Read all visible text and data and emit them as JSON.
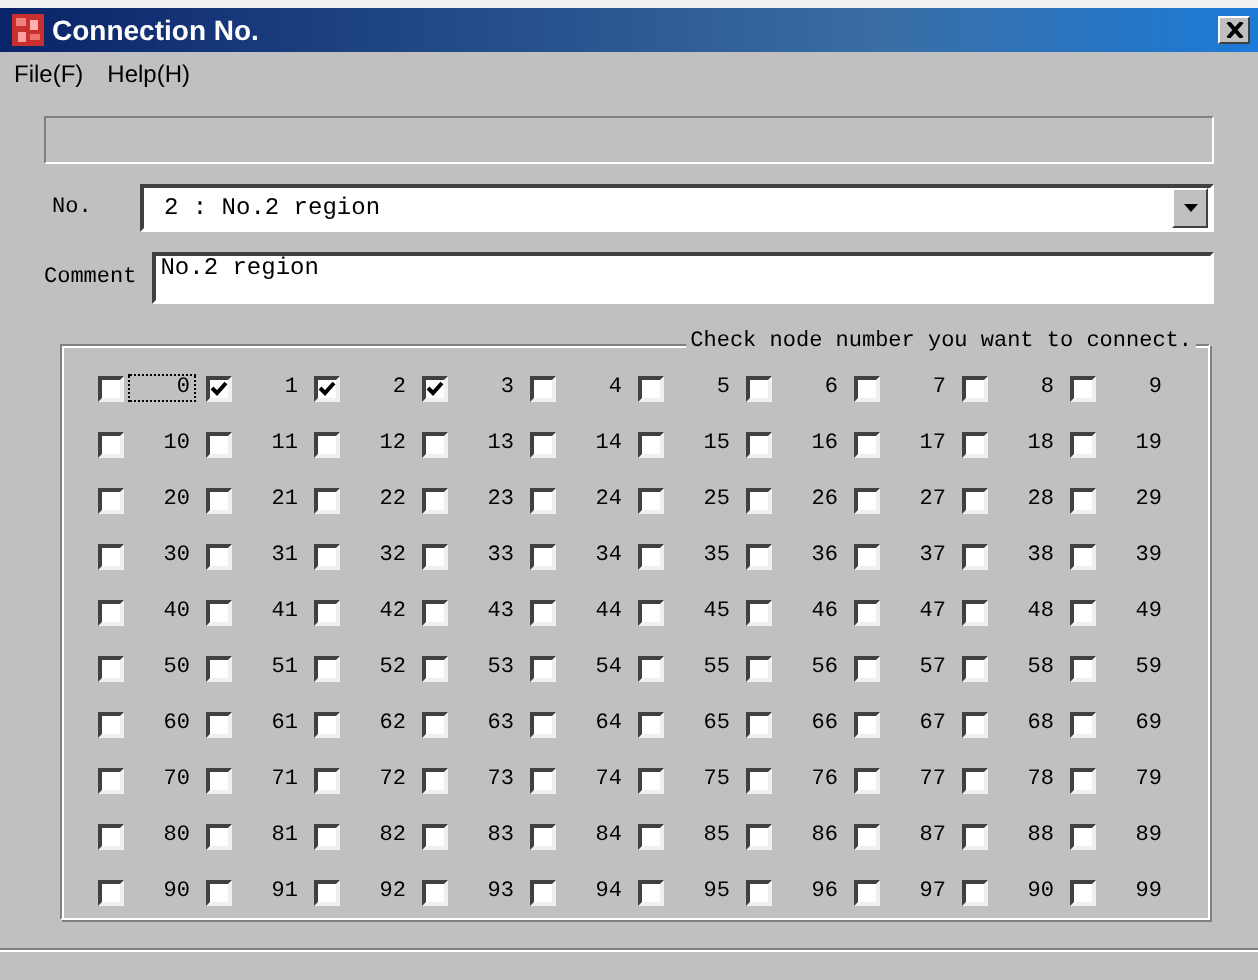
{
  "window": {
    "title": "Connection No."
  },
  "menu": [
    {
      "label": "File(F)"
    },
    {
      "label": "Help(H)"
    }
  ],
  "no": {
    "label": "No.",
    "value": "2 : No.2 region"
  },
  "comment": {
    "label": "Comment",
    "value": "No.2 region"
  },
  "group": {
    "title": "Check node number you want to connect.",
    "nodes": [
      {
        "label": "0",
        "checked": false,
        "focused": true
      },
      {
        "label": "1",
        "checked": true,
        "focused": false
      },
      {
        "label": "2",
        "checked": true,
        "focused": false
      },
      {
        "label": "3",
        "checked": true,
        "focused": false
      },
      {
        "label": "4",
        "checked": false,
        "focused": false
      },
      {
        "label": "5",
        "checked": false,
        "focused": false
      },
      {
        "label": "6",
        "checked": false,
        "focused": false
      },
      {
        "label": "7",
        "checked": false,
        "focused": false
      },
      {
        "label": "8",
        "checked": false,
        "focused": false
      },
      {
        "label": "9",
        "checked": false,
        "focused": false
      },
      {
        "label": "10",
        "checked": false,
        "focused": false
      },
      {
        "label": "11",
        "checked": false,
        "focused": false
      },
      {
        "label": "12",
        "checked": false,
        "focused": false
      },
      {
        "label": "13",
        "checked": false,
        "focused": false
      },
      {
        "label": "14",
        "checked": false,
        "focused": false
      },
      {
        "label": "15",
        "checked": false,
        "focused": false
      },
      {
        "label": "16",
        "checked": false,
        "focused": false
      },
      {
        "label": "17",
        "checked": false,
        "focused": false
      },
      {
        "label": "18",
        "checked": false,
        "focused": false
      },
      {
        "label": "19",
        "checked": false,
        "focused": false
      },
      {
        "label": "20",
        "checked": false,
        "focused": false
      },
      {
        "label": "21",
        "checked": false,
        "focused": false
      },
      {
        "label": "22",
        "checked": false,
        "focused": false
      },
      {
        "label": "23",
        "checked": false,
        "focused": false
      },
      {
        "label": "24",
        "checked": false,
        "focused": false
      },
      {
        "label": "25",
        "checked": false,
        "focused": false
      },
      {
        "label": "26",
        "checked": false,
        "focused": false
      },
      {
        "label": "27",
        "checked": false,
        "focused": false
      },
      {
        "label": "28",
        "checked": false,
        "focused": false
      },
      {
        "label": "29",
        "checked": false,
        "focused": false
      },
      {
        "label": "30",
        "checked": false,
        "focused": false
      },
      {
        "label": "31",
        "checked": false,
        "focused": false
      },
      {
        "label": "32",
        "checked": false,
        "focused": false
      },
      {
        "label": "33",
        "checked": false,
        "focused": false
      },
      {
        "label": "34",
        "checked": false,
        "focused": false
      },
      {
        "label": "35",
        "checked": false,
        "focused": false
      },
      {
        "label": "36",
        "checked": false,
        "focused": false
      },
      {
        "label": "37",
        "checked": false,
        "focused": false
      },
      {
        "label": "38",
        "checked": false,
        "focused": false
      },
      {
        "label": "39",
        "checked": false,
        "focused": false
      },
      {
        "label": "40",
        "checked": false,
        "focused": false
      },
      {
        "label": "41",
        "checked": false,
        "focused": false
      },
      {
        "label": "42",
        "checked": false,
        "focused": false
      },
      {
        "label": "43",
        "checked": false,
        "focused": false
      },
      {
        "label": "44",
        "checked": false,
        "focused": false
      },
      {
        "label": "45",
        "checked": false,
        "focused": false
      },
      {
        "label": "46",
        "checked": false,
        "focused": false
      },
      {
        "label": "47",
        "checked": false,
        "focused": false
      },
      {
        "label": "48",
        "checked": false,
        "focused": false
      },
      {
        "label": "49",
        "checked": false,
        "focused": false
      },
      {
        "label": "50",
        "checked": false,
        "focused": false
      },
      {
        "label": "51",
        "checked": false,
        "focused": false
      },
      {
        "label": "52",
        "checked": false,
        "focused": false
      },
      {
        "label": "53",
        "checked": false,
        "focused": false
      },
      {
        "label": "54",
        "checked": false,
        "focused": false
      },
      {
        "label": "55",
        "checked": false,
        "focused": false
      },
      {
        "label": "56",
        "checked": false,
        "focused": false
      },
      {
        "label": "57",
        "checked": false,
        "focused": false
      },
      {
        "label": "58",
        "checked": false,
        "focused": false
      },
      {
        "label": "59",
        "checked": false,
        "focused": false
      },
      {
        "label": "60",
        "checked": false,
        "focused": false
      },
      {
        "label": "61",
        "checked": false,
        "focused": false
      },
      {
        "label": "62",
        "checked": false,
        "focused": false
      },
      {
        "label": "63",
        "checked": false,
        "focused": false
      },
      {
        "label": "64",
        "checked": false,
        "focused": false
      },
      {
        "label": "65",
        "checked": false,
        "focused": false
      },
      {
        "label": "66",
        "checked": false,
        "focused": false
      },
      {
        "label": "67",
        "checked": false,
        "focused": false
      },
      {
        "label": "68",
        "checked": false,
        "focused": false
      },
      {
        "label": "69",
        "checked": false,
        "focused": false
      },
      {
        "label": "70",
        "checked": false,
        "focused": false
      },
      {
        "label": "71",
        "checked": false,
        "focused": false
      },
      {
        "label": "72",
        "checked": false,
        "focused": false
      },
      {
        "label": "73",
        "checked": false,
        "focused": false
      },
      {
        "label": "74",
        "checked": false,
        "focused": false
      },
      {
        "label": "75",
        "checked": false,
        "focused": false
      },
      {
        "label": "76",
        "checked": false,
        "focused": false
      },
      {
        "label": "77",
        "checked": false,
        "focused": false
      },
      {
        "label": "78",
        "checked": false,
        "focused": false
      },
      {
        "label": "79",
        "checked": false,
        "focused": false
      },
      {
        "label": "80",
        "checked": false,
        "focused": false
      },
      {
        "label": "81",
        "checked": false,
        "focused": false
      },
      {
        "label": "82",
        "checked": false,
        "focused": false
      },
      {
        "label": "83",
        "checked": false,
        "focused": false
      },
      {
        "label": "84",
        "checked": false,
        "focused": false
      },
      {
        "label": "85",
        "checked": false,
        "focused": false
      },
      {
        "label": "86",
        "checked": false,
        "focused": false
      },
      {
        "label": "87",
        "checked": false,
        "focused": false
      },
      {
        "label": "88",
        "checked": false,
        "focused": false
      },
      {
        "label": "89",
        "checked": false,
        "focused": false
      },
      {
        "label": "90",
        "checked": false,
        "focused": false
      },
      {
        "label": "91",
        "checked": false,
        "focused": false
      },
      {
        "label": "92",
        "checked": false,
        "focused": false
      },
      {
        "label": "93",
        "checked": false,
        "focused": false
      },
      {
        "label": "94",
        "checked": false,
        "focused": false
      },
      {
        "label": "95",
        "checked": false,
        "focused": false
      },
      {
        "label": "96",
        "checked": false,
        "focused": false
      },
      {
        "label": "97",
        "checked": false,
        "focused": false
      },
      {
        "label": "90",
        "checked": false,
        "focused": false
      },
      {
        "label": "99",
        "checked": false,
        "focused": false
      }
    ]
  }
}
